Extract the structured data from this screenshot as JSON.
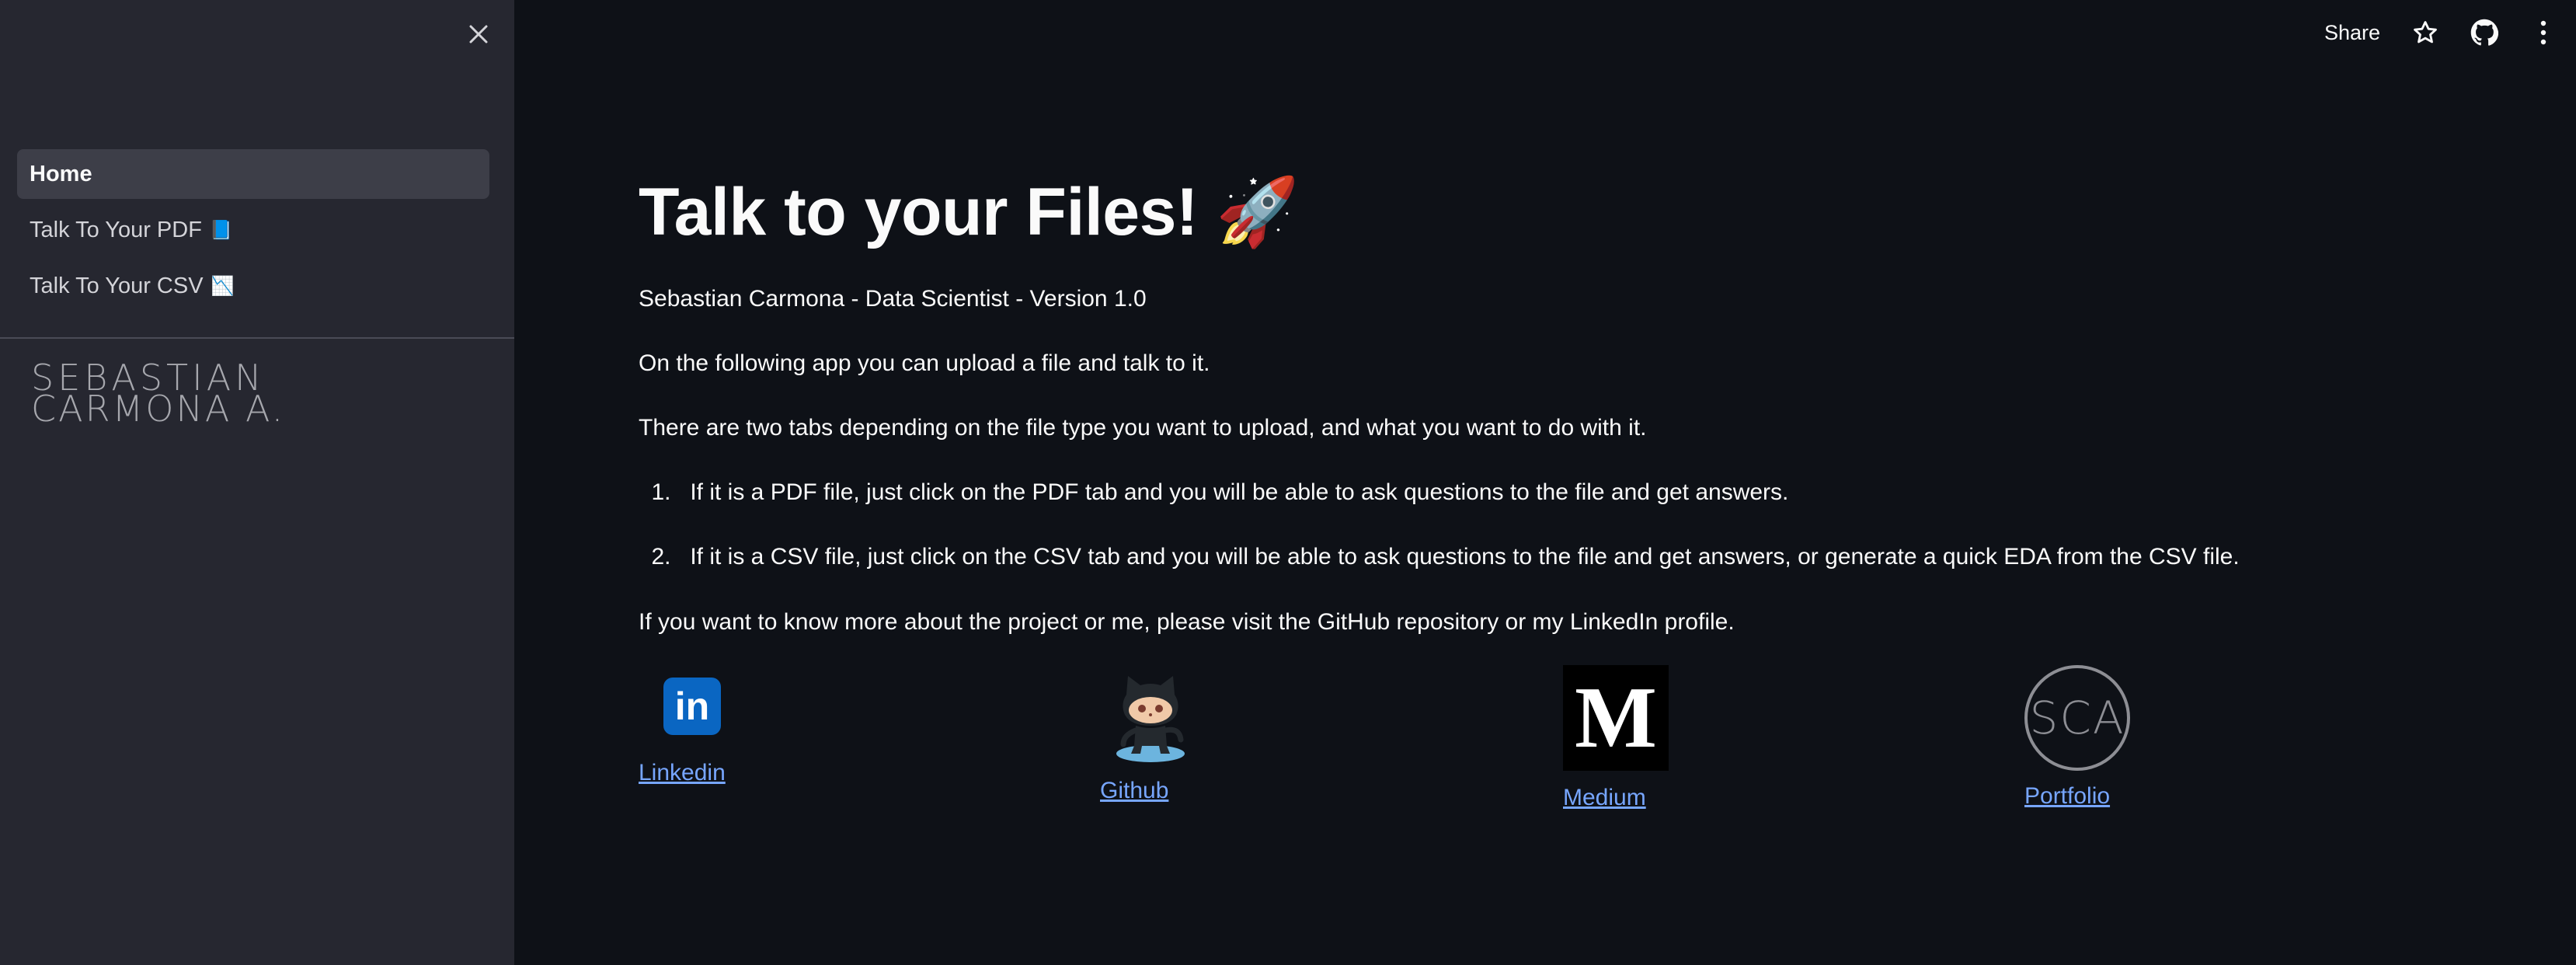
{
  "sidebar": {
    "items": [
      {
        "label": "Home",
        "emoji": ""
      },
      {
        "label": "Talk To Your PDF",
        "emoji": "📘"
      },
      {
        "label": "Talk To Your CSV",
        "emoji": "📉"
      }
    ],
    "logo_line1": "SEBASTIAN",
    "logo_line2": "CARMONA A."
  },
  "toolbar": {
    "share_label": "Share"
  },
  "main": {
    "title": "Talk to your Files! 🚀",
    "byline": "Sebastian Carmona - Data Scientist - Version 1.0",
    "intro": "On the following app you can upload a file and talk to it.",
    "tabs_desc": "There are two tabs depending on the file type you want to upload, and what you want to do with it.",
    "list": [
      {
        "num": "1.",
        "text": "If it is a PDF file, just click on the PDF tab and you will be able to ask questions to the file and get answers."
      },
      {
        "num": "2.",
        "text": "If it is a CSV file, just click on the CSV tab and you will be able to ask questions to the file and get answers, or generate a quick EDA from the CSV file."
      }
    ],
    "outro": "If you want to know more about the project or me, please visit the GitHub repository or my LinkedIn profile."
  },
  "links": {
    "linkedin": {
      "label": "Linkedin",
      "icon_text": "in"
    },
    "github": {
      "label": "Github"
    },
    "medium": {
      "label": "Medium",
      "icon_text": "M"
    },
    "portfolio": {
      "label": "Portfolio",
      "icon_text": "SCA"
    }
  },
  "colors": {
    "background": "#0e1117",
    "sidebar": "#262730",
    "link": "#77a6ff"
  }
}
